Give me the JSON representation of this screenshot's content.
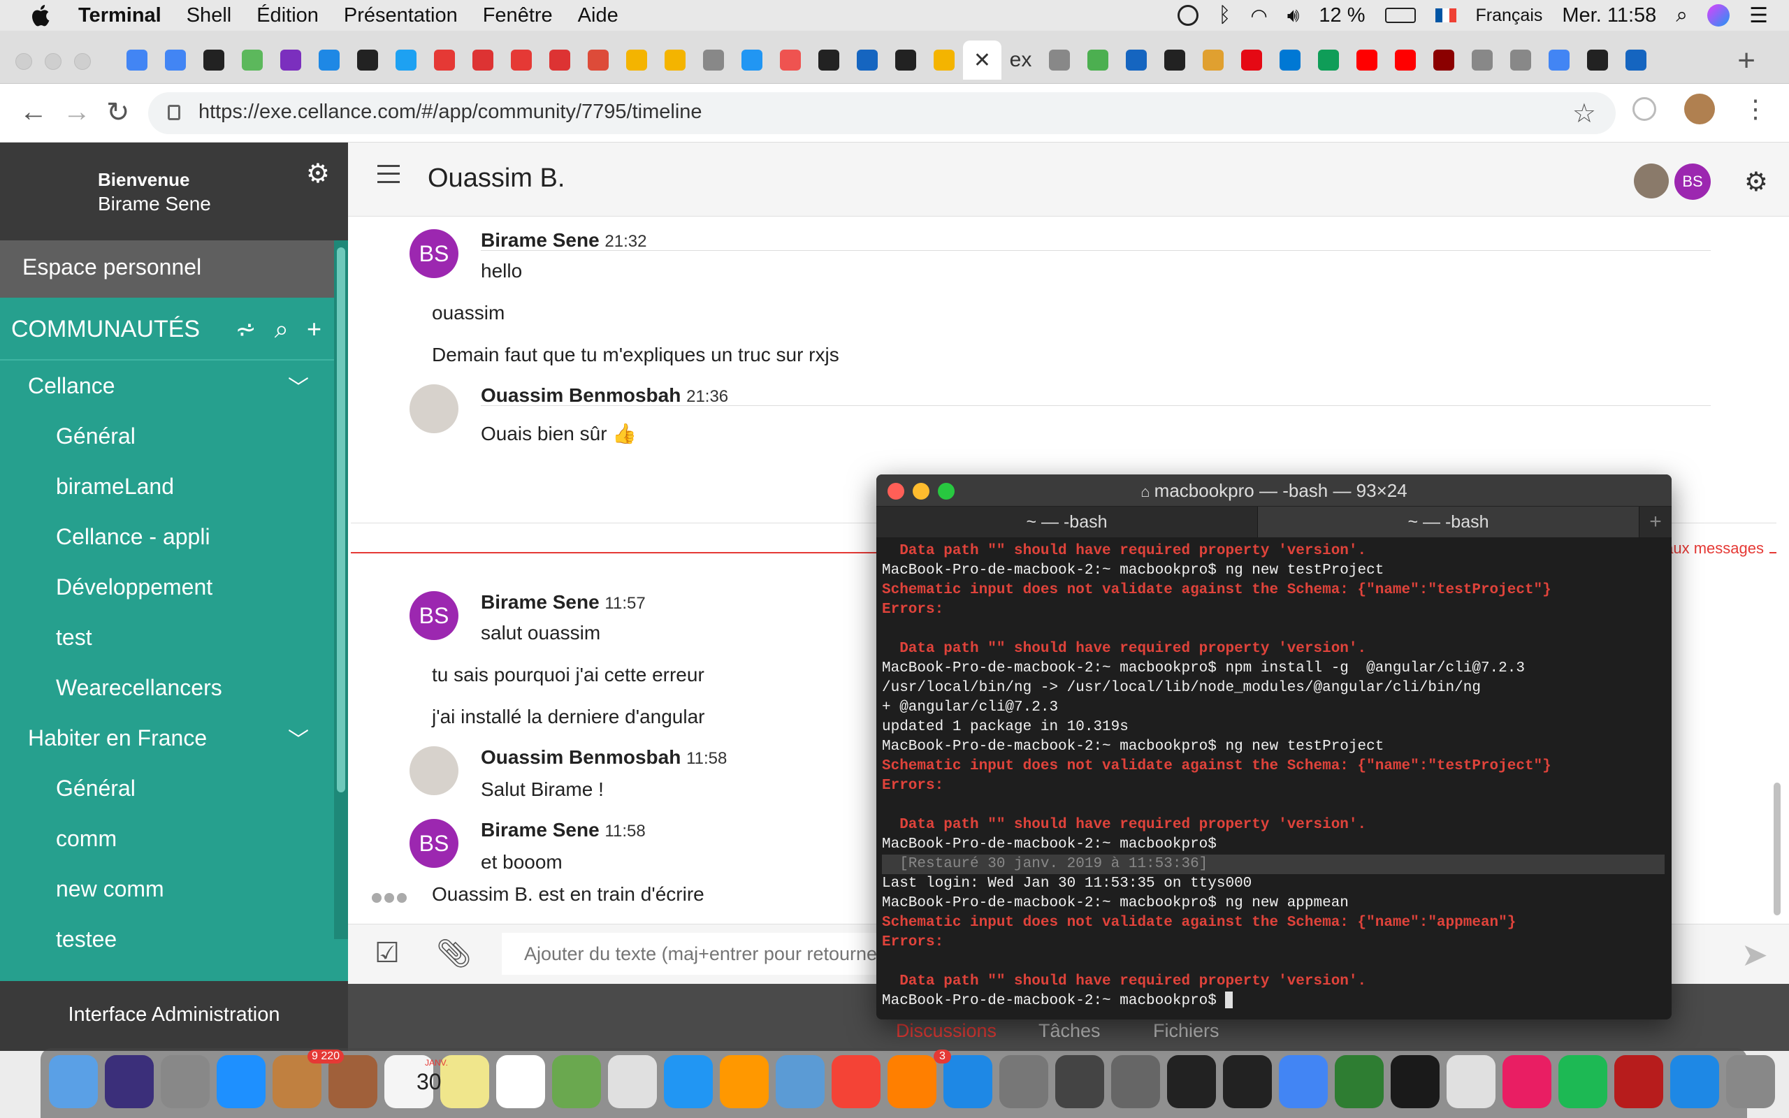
{
  "menubar": {
    "app": "Terminal",
    "items": [
      "Shell",
      "Édition",
      "Présentation",
      "Fenêtre",
      "Aide"
    ],
    "battery": "12 %",
    "language": "Français",
    "clock": "Mer. 11:58"
  },
  "browser": {
    "url": "https://exe.cellance.com/#/app/community/7795/timeline",
    "active_tab_label": "ex",
    "tab_colors": [
      "#4285f4",
      "#4285f4",
      "#222",
      "#5cb85c",
      "#7b2fbe",
      "#1e88e5",
      "#222",
      "#1da1f2",
      "#e53935",
      "#dd3333",
      "#e53935",
      "#dd3333",
      "#dd4b39",
      "#f4b400",
      "#f4b400",
      "#888",
      "#2196f3",
      "#ef5350",
      "#222",
      "#1565c0",
      "#222",
      "#f4b400"
    ],
    "tab_colors_after": [
      "#888",
      "#4caf50",
      "#1565c0",
      "#222",
      "#e0a030",
      "#e50914",
      "#0078d4",
      "#0f9d58",
      "#ff0000",
      "#ff0000",
      "#8b0000",
      "#888",
      "#888",
      "#4285f4",
      "#222",
      "#1565c0"
    ]
  },
  "sidebar": {
    "welcome": "Bienvenue",
    "username": "Birame Sene",
    "personal": "Espace personnel",
    "communities_title": "COMMUNAUTÉS",
    "items": [
      {
        "label": "Cellance",
        "type": "group"
      },
      {
        "label": "Général",
        "type": "channel"
      },
      {
        "label": "birameLand",
        "type": "channel"
      },
      {
        "label": "Cellance - appli",
        "type": "channel"
      },
      {
        "label": "Développement",
        "type": "channel"
      },
      {
        "label": "test",
        "type": "channel"
      },
      {
        "label": "Wearecellancers",
        "type": "channel"
      },
      {
        "label": "Habiter en France",
        "type": "group"
      },
      {
        "label": "Général",
        "type": "channel"
      },
      {
        "label": "comm",
        "type": "channel"
      },
      {
        "label": "new comm",
        "type": "channel"
      },
      {
        "label": "testee",
        "type": "channel"
      }
    ],
    "admin": "Interface Administration",
    "accent": "#26a08e"
  },
  "chat": {
    "title": "Ouassim B.",
    "avatar_initials": "BS",
    "messages": [
      {
        "author": "Birame Sene",
        "time": "21:32",
        "lines": [
          "hello"
        ]
      },
      {
        "author": "",
        "time": "",
        "lines": [
          "ouassim"
        ]
      },
      {
        "author": "",
        "time": "",
        "lines": [
          "Demain faut que tu m'expliques un truc sur rxjs"
        ]
      },
      {
        "author": "Ouassim Benmosbah",
        "time": "21:36",
        "lines": [
          "Ouais bien sûr 👍"
        ]
      },
      {
        "author": "Birame Sene",
        "time": "11:57",
        "lines": [
          "salut ouassim"
        ]
      },
      {
        "author": "",
        "time": "",
        "lines": [
          "tu sais pourquoi j'ai cette erreur"
        ]
      },
      {
        "author": "",
        "time": "",
        "lines": [
          "j'ai installé la derniere d'angular"
        ]
      },
      {
        "author": "Ouassim Benmosbah",
        "time": "11:58",
        "lines": [
          "Salut Birame !"
        ]
      },
      {
        "author": "Birame Sene",
        "time": "11:58",
        "lines": [
          "et booom"
        ]
      }
    ],
    "new_messages_label": "Nouveaux messages",
    "typing": "Ouassim B. est en train d'écrire",
    "input_placeholder": "Ajouter du texte (maj+entrer pour retourner à la ligne)",
    "bottom_tabs": [
      "Discussions",
      "Tâches",
      "Fichiers"
    ]
  },
  "terminal": {
    "title": "macbookpro — -bash — 93×24",
    "tabs": [
      "~ — -bash",
      "~ — -bash"
    ],
    "lines": [
      {
        "t": "  Data path \"\" should have required property 'version'.",
        "k": "err"
      },
      {
        "t": "MacBook-Pro-de-macbook-2:~ macbookpro$ ng new testProject",
        "k": "norm"
      },
      {
        "t": "Schematic input does not validate against the Schema: {\"name\":\"testProject\"}",
        "k": "err"
      },
      {
        "t": "Errors:",
        "k": "err"
      },
      {
        "t": "",
        "k": "norm"
      },
      {
        "t": "  Data path \"\" should have required property 'version'.",
        "k": "err"
      },
      {
        "t": "MacBook-Pro-de-macbook-2:~ macbookpro$ npm install -g  @angular/cli@7.2.3",
        "k": "norm"
      },
      {
        "t": "/usr/local/bin/ng -> /usr/local/lib/node_modules/@angular/cli/bin/ng",
        "k": "norm"
      },
      {
        "t": "+ @angular/cli@7.2.3",
        "k": "norm"
      },
      {
        "t": "updated 1 package in 10.319s",
        "k": "norm"
      },
      {
        "t": "MacBook-Pro-de-macbook-2:~ macbookpro$ ng new testProject",
        "k": "norm"
      },
      {
        "t": "Schematic input does not validate against the Schema: {\"name\":\"testProject\"}",
        "k": "err"
      },
      {
        "t": "Errors:",
        "k": "err"
      },
      {
        "t": "",
        "k": "norm"
      },
      {
        "t": "  Data path \"\" should have required property 'version'.",
        "k": "err"
      },
      {
        "t": "MacBook-Pro-de-macbook-2:~ macbookpro$",
        "k": "norm"
      },
      {
        "t": "  [Restauré 30 janv. 2019 à 11:53:36]",
        "k": "rest"
      },
      {
        "t": "Last login: Wed Jan 30 11:53:35 on ttys000",
        "k": "norm"
      },
      {
        "t": "MacBook-Pro-de-macbook-2:~ macbookpro$ ng new appmean",
        "k": "norm"
      },
      {
        "t": "Schematic input does not validate against the Schema: {\"name\":\"appmean\"}",
        "k": "err"
      },
      {
        "t": "Errors:",
        "k": "err"
      },
      {
        "t": "",
        "k": "norm"
      },
      {
        "t": "  Data path \"\" should have required property 'version'.",
        "k": "err"
      },
      {
        "t": "MacBook-Pro-de-macbook-2:~ macbookpro$ ",
        "k": "norm"
      }
    ]
  },
  "dock": {
    "badges": {
      "mail": "9 220",
      "appstore": "3"
    },
    "calendar": {
      "month": "JANV.",
      "day": "30"
    },
    "icon_colors": [
      "#5aa0e6",
      "#3b2f7a",
      "#888",
      "#1e90ff",
      "#c08040",
      "#a0603a",
      "#f5f5f5",
      "#f0e68c",
      "#ffffff",
      "#6aa84f",
      "#e0e0e0",
      "#2196f3",
      "#ff9800",
      "#5b9bd5",
      "#f44336",
      "#ff7f00",
      "#1e88e5",
      "#777",
      "#444",
      "#666",
      "#222",
      "#222",
      "#4285f4",
      "#2e7d32",
      "#1a1a1a",
      "#e0e0e0",
      "#e91e63",
      "#1db954",
      "#b71c1c",
      "#1e88e5",
      "#888"
    ]
  }
}
